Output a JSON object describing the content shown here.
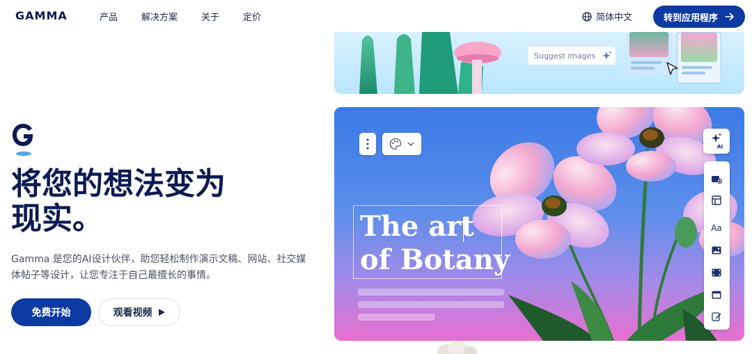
{
  "nav": {
    "logo": "GAMMA",
    "links": [
      "产品",
      "解决方案",
      "关于",
      "定价"
    ],
    "language": "简体中文",
    "cta_label": "转到应用程序"
  },
  "hero": {
    "headline_line1": "将您的想法变为",
    "headline_line2": "现实。",
    "description": "Gamma 是您的AI设计伙伴，助您轻松制作演示文稿、网站、社交媒体帖子等设计，让您专注于自己最擅长的事情。",
    "primary_button": "免费开始",
    "secondary_button": "观看视频"
  },
  "preview": {
    "suggest_label": "Suggest images",
    "card_title_line1": "The art",
    "card_title_line2": "of Botany",
    "ai_badge": "AI",
    "font_tool_label": "Aa"
  },
  "colors": {
    "brand_dark": "#0b1a52",
    "brand_blue": "#0d3aa1",
    "card_gradient_top": "#3b7ae6",
    "card_gradient_bottom": "#e86fcf"
  },
  "icons": [
    "globe-icon",
    "arrow-right-icon",
    "play-icon",
    "sparkle-icon",
    "palette-icon",
    "chevron-down-icon",
    "more-vertical-icon",
    "cursor-icon",
    "card-add-icon",
    "layout-icon",
    "font-icon",
    "image-icon",
    "video-icon",
    "embed-icon",
    "edit-icon"
  ]
}
